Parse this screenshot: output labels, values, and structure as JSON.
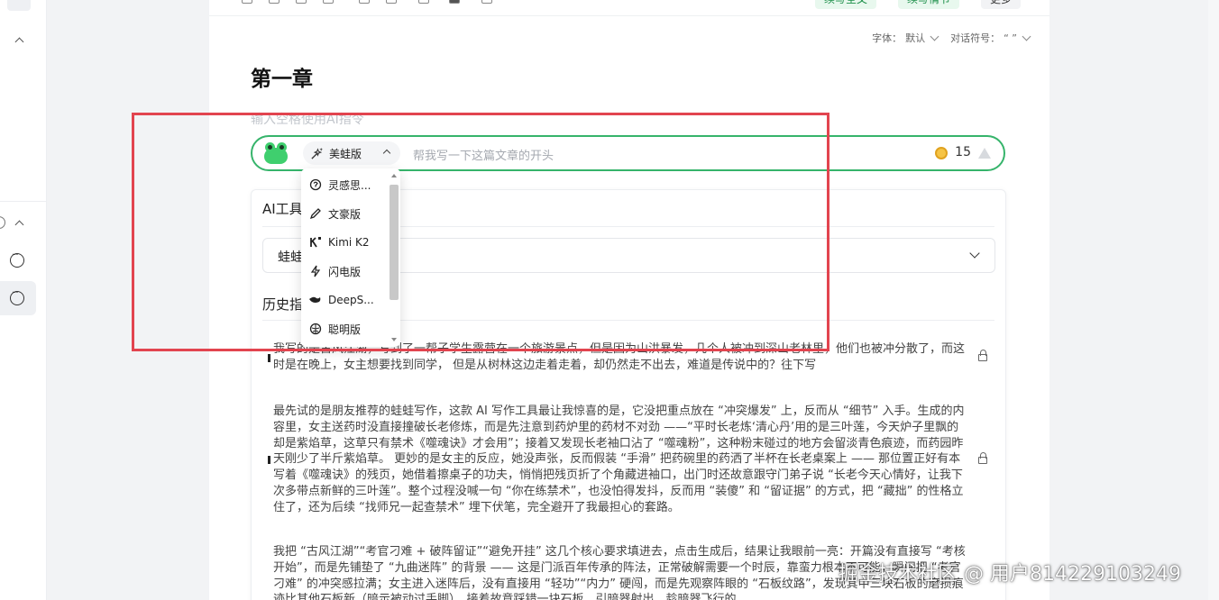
{
  "toolbar": {
    "btn1": "续写全文",
    "btn2": "续写情节",
    "more": "更多"
  },
  "doc_options": {
    "font_label": "字体：",
    "font_value": "默认",
    "dialog_label": "对话符号：",
    "dialog_value": "“ ”"
  },
  "chapter_title": "第一章",
  "ai_input": {
    "hint": "输入空格使用AI指令",
    "model": "美蛙版",
    "placeholder": "帮我写一下这篇文章的开头",
    "credits": "15"
  },
  "model_menu": [
    {
      "label": "灵感思...",
      "icon": "bulb-icon"
    },
    {
      "label": "文豪版",
      "icon": "pen-icon"
    },
    {
      "label": "Kimi K2",
      "icon": "kimi-icon"
    },
    {
      "label": "闪电版",
      "icon": "lightning-icon"
    },
    {
      "label": "DeepS...",
      "icon": "whale-icon"
    },
    {
      "label": "聪明版",
      "icon": "brain-icon"
    }
  ],
  "tools_panel": {
    "title": "AI工具",
    "select_value": "蛙蛙",
    "history_title": "历史指令"
  },
  "history": [
    {
      "text": "我写的是古风江湖，写到了一帮子学生露营在一个旅游景点，但是因为山洪暴发，几个人被冲到深山老林里，他们也被冲分散了，而这时是在晚上，女主想要找到同学， 但是从树林这边走着走着，却仍然走不出去，难道是传说中的？往下写"
    },
    {
      "text": "最先试的是朋友推荐的蛙蛙写作，这款 AI 写作工具最让我惊喜的是，它没把重点放在 “冲突爆发” 上，反而从 “细节” 入手。生成的内容里，女主送药时没直接撞破长老修炼，而是先注意到药炉里的药材不对劲 ——“平时长老炼‘清心丹’用的是三叶莲，今天炉子里飘的却是紫焰草，这草只有禁术《噬魂诀》才会用”；接着又发现长老袖口沾了 “噬魂粉”，这种粉末碰过的地方会留淡青色痕迹，而药园昨天刚少了半斤紫焰草。 更妙的是女主的反应，她没声张，反而假装 “手滑” 把药碗里的药洒了半杯在长老桌案上 —— 那位置正好有本写着《噬魂诀》的残页，她借着擦桌子的功夫，悄悄把残页折了个角藏进袖口，出门时还故意跟守门弟子说 “长老今天心情好，让我下次多带点新鲜的三叶莲”。整个过程没喊一句 “你在练禁术”，也没怕得发抖，反而用 “装傻” 和 “留证据” 的方式，把 “藏拙” 的性格立住了，还为后续 “找师兄一起查禁术” 埋下伏笔，完全避开了我最担心的套路。"
    },
    {
      "text": "我把 “古风江湖”“考官刁难 + 破阵留证”“避免开挂” 这几个核心要求填进去，点击生成后，结果让我眼前一亮：开篇没有直接写 “考核开始”，而是先铺垫了 “九曲迷阵” 的背景 —— 这是门派百年传承的阵法，正常破解需要一个时辰，靠蛮力根本不可能，瞬间把 “考官刁难” 的冲突感拉满；女主进入迷阵后，没有直接用 “轻功”“内力” 硬闯，而是先观察阵眼的 “石板纹路”，发现其中三块石板的磨损痕迹比其他石板新（暗示被动过手脚），接着故意踩错一块石板，引暗器射出，趁暗器飞行的"
    }
  ],
  "watermark": "掘金技术社区 @ 用户814229103249"
}
